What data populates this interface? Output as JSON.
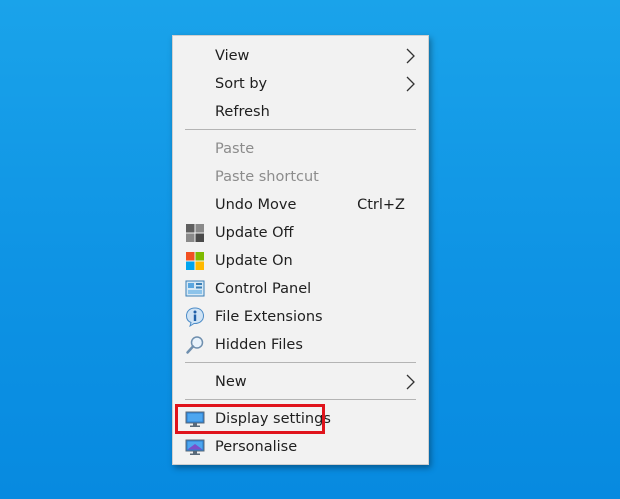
{
  "menu": {
    "view": "View",
    "sort_by": "Sort by",
    "refresh": "Refresh",
    "paste": "Paste",
    "paste_shortcut": "Paste shortcut",
    "undo_move": "Undo Move",
    "undo_move_shortcut": "Ctrl+Z",
    "update_off": "Update Off",
    "update_on": "Update On",
    "control_panel": "Control Panel",
    "file_extensions": "File Extensions",
    "hidden_files": "Hidden Files",
    "new": "New",
    "display_settings": "Display settings",
    "personalise": "Personalise"
  },
  "icons": {
    "update_off": "windows-logo-gray-icon",
    "update_on": "windows-logo-color-icon",
    "control_panel": "control-panel-icon",
    "file_extensions": "info-icon",
    "hidden_files": "magnifier-icon",
    "display_settings": "monitor-icon",
    "personalise": "personalise-icon"
  },
  "colors": {
    "desktop": "#0e93e4",
    "menu_bg": "#f2f2f2",
    "highlight_border": "#e0141c",
    "disabled_text": "#8c8c8c"
  }
}
